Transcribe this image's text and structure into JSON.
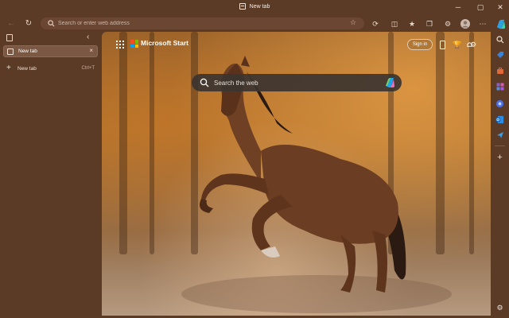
{
  "window": {
    "title": "New tab",
    "minimize_glyph": "─",
    "maximize_glyph": "▢",
    "close_glyph": "✕"
  },
  "toolbar": {
    "address_placeholder": "Search or enter web address",
    "icons": [
      "back-icon",
      "refresh-icon",
      "favorite-star-icon",
      "copilot-refresh-icon",
      "split-screen-icon",
      "favorites-icon",
      "collections-icon",
      "extensions-icon",
      "profile-avatar",
      "more-menu-icon",
      "copilot-icon"
    ]
  },
  "vertical_tabs": {
    "active_tab_label": "New tab",
    "new_tab_label": "New tab",
    "new_tab_shortcut": "Ctrl+T"
  },
  "new_tab_page": {
    "brand": "Microsoft Start",
    "signin_label": "Sign in",
    "search_placeholder": "Search the web",
    "logo_colors": [
      "#f25022",
      "#7fba00",
      "#00a4ef",
      "#ffb900"
    ]
  },
  "sidebar": {
    "icons": [
      "search-icon",
      "shopping-tag-icon",
      "tools-briefcase-icon",
      "games-icon",
      "copilot-app-icon",
      "outlook-icon",
      "send-icon",
      "add-icon",
      "settings-icon"
    ]
  }
}
